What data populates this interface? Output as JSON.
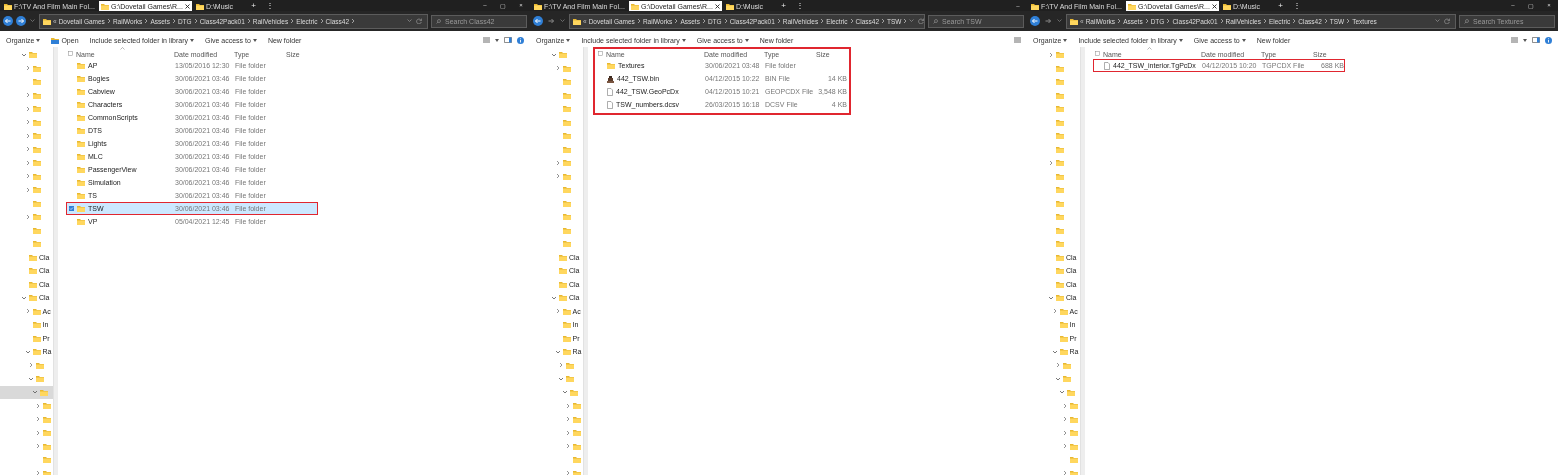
{
  "windows": [
    {
      "tabs": [
        {
          "label": "F:\\TV And Film Main Fol...",
          "selected": false
        },
        {
          "label": "G:\\Dovetail Games\\R...",
          "selected": true
        },
        {
          "label": "D:\\Music",
          "selected": false
        }
      ],
      "new_tab": "+",
      "tab_menu": "⋮",
      "window_controls": [
        "–",
        "▢",
        "×"
      ],
      "back_enabled": true,
      "forward_enabled": true,
      "address": {
        "overflow": "«",
        "crumbs": [
          "Dovetail Games",
          "RailWorks",
          "Assets",
          "DTG",
          "Class42Pack01",
          "RailVehicles",
          "Electric",
          "Class42"
        ],
        "trailing_chevron": true
      },
      "search": {
        "placeholder": "Search Class42"
      },
      "toolbar": [
        {
          "label": "Organize",
          "dropdown": true,
          "icon": false
        },
        {
          "label": "Open",
          "dropdown": false,
          "icon": true
        },
        {
          "label": "Include selected folder in library",
          "dropdown": true,
          "icon": false
        },
        {
          "label": "Give access to",
          "dropdown": true,
          "icon": false
        },
        {
          "label": "New folder",
          "dropdown": false,
          "icon": false
        }
      ],
      "view_buttons": [
        {
          "kind": "list"
        },
        {
          "kind": "caret"
        },
        {
          "kind": "pane"
        },
        {
          "kind": "help"
        }
      ],
      "tree": [
        {
          "expandable": true,
          "expanded": true,
          "selected": false,
          "children": [
            {
              "expandable": true,
              "expanded": false,
              "selected": false
            },
            {
              "expandable": false,
              "selected": false
            },
            {
              "expandable": true,
              "expanded": false,
              "selected": false
            },
            {
              "expandable": true,
              "expanded": false,
              "selected": false
            },
            {
              "expandable": true,
              "expanded": false,
              "selected": false
            },
            {
              "expandable": true,
              "expanded": false,
              "selected": false
            },
            {
              "expandable": true,
              "expanded": false,
              "selected": false
            },
            {
              "expandable": true,
              "expanded": false,
              "selected": false
            },
            {
              "expandable": true,
              "expanded": false,
              "selected": false
            },
            {
              "expandable": true,
              "expanded": false,
              "selected": false
            },
            {
              "expandable": false,
              "selected": false
            },
            {
              "expandable": true,
              "expanded": false,
              "selected": false
            },
            {
              "expandable": false,
              "selected": false
            },
            {
              "expandable": false,
              "selected": false
            }
          ]
        },
        {
          "label": "Cla",
          "expandable": false,
          "selected": false
        },
        {
          "label": "Cla",
          "expandable": false,
          "selected": false
        },
        {
          "label": "Cla",
          "expandable": false,
          "selected": false
        },
        {
          "label": "Cla",
          "expandable": true,
          "expanded": true,
          "selected": false,
          "children": [
            {
              "label": "Ac",
              "expandable": true,
              "expanded": false,
              "selected": false
            },
            {
              "label": "In",
              "expandable": false,
              "selected": false
            },
            {
              "label": "Pr",
              "expandable": false,
              "selected": false
            },
            {
              "label": "Ra",
              "expandable": true,
              "expanded": true,
              "selected": false,
              "children": [
                {
                  "expandable": true,
                  "expanded": false,
                  "selected": false
                },
                {
                  "expandable": true,
                  "expanded": true,
                  "selected": false,
                  "children": [
                    {
                      "expandable": true,
                      "expanded": true,
                      "selected": true,
                      "children": [
                        {
                          "expandable": true,
                          "expanded": false,
                          "selected": false
                        },
                        {
                          "expandable": true,
                          "expanded": false,
                          "selected": false
                        },
                        {
                          "expandable": true,
                          "expanded": false,
                          "selected": false
                        },
                        {
                          "expandable": true,
                          "expanded": false,
                          "selected": false
                        },
                        {
                          "expandable": false,
                          "selected": false
                        },
                        {
                          "expandable": true,
                          "expanded": false,
                          "selected": false
                        }
                      ]
                    }
                  ]
                }
              ]
            }
          ]
        }
      ],
      "columns": [
        {
          "label": "Name",
          "sorted": true
        },
        {
          "label": "Date modified",
          "sorted": false
        },
        {
          "label": "Type",
          "sorted": false
        },
        {
          "label": "Size",
          "sorted": false
        }
      ],
      "header_checkbox": {
        "checked": false
      },
      "list_highlighted": false,
      "rows": [
        {
          "kind": "folder",
          "name": "AP",
          "date": "13/05/2016 12:30",
          "type": "File folder",
          "selected": false,
          "highlighted": false
        },
        {
          "kind": "folder",
          "name": "Bogies",
          "date": "30/06/2021 03:46",
          "type": "File folder",
          "selected": false,
          "highlighted": false
        },
        {
          "kind": "folder",
          "name": "Cabview",
          "date": "30/06/2021 03:46",
          "type": "File folder",
          "selected": false,
          "highlighted": false
        },
        {
          "kind": "folder",
          "name": "Characters",
          "date": "30/06/2021 03:46",
          "type": "File folder",
          "selected": false,
          "highlighted": false
        },
        {
          "kind": "folder",
          "name": "CommonScripts",
          "date": "30/06/2021 03:46",
          "type": "File folder",
          "selected": false,
          "highlighted": false
        },
        {
          "kind": "folder",
          "name": "DTS",
          "date": "30/06/2021 03:46",
          "type": "File folder",
          "selected": false,
          "highlighted": false
        },
        {
          "kind": "folder",
          "name": "Lights",
          "date": "30/06/2021 03:46",
          "type": "File folder",
          "selected": false,
          "highlighted": false
        },
        {
          "kind": "folder",
          "name": "MLC",
          "date": "30/06/2021 03:46",
          "type": "File folder",
          "selected": false,
          "highlighted": false
        },
        {
          "kind": "folder",
          "name": "PassengerView",
          "date": "30/06/2021 03:46",
          "type": "File folder",
          "selected": false,
          "highlighted": false
        },
        {
          "kind": "folder",
          "name": "Simulation",
          "date": "30/06/2021 03:46",
          "type": "File folder",
          "selected": false,
          "highlighted": false
        },
        {
          "kind": "folder",
          "name": "TS",
          "date": "30/06/2021 03:46",
          "type": "File folder",
          "selected": false,
          "highlighted": false
        },
        {
          "kind": "folder",
          "name": "TSW",
          "date": "30/06/2021 03:46",
          "type": "File folder",
          "selected": true,
          "highlighted": true
        },
        {
          "kind": "folder",
          "name": "VP",
          "date": "05/04/2021 12:45",
          "type": "File folder",
          "selected": false,
          "highlighted": false
        }
      ]
    },
    {
      "tabs": [
        {
          "label": "F:\\TV And Film Main Fol...",
          "selected": false
        },
        {
          "label": "G:\\Dovetail Games\\R...",
          "selected": true
        },
        {
          "label": "D:\\Music",
          "selected": false
        }
      ],
      "new_tab": "+",
      "tab_menu": "⋮",
      "window_controls": [
        "–"
      ],
      "back_enabled": true,
      "forward_enabled": false,
      "address": {
        "overflow": "«",
        "crumbs": [
          "Dovetail Games",
          "RailWorks",
          "Assets",
          "DTG",
          "Class42Pack01",
          "RailVehicles",
          "Electric",
          "Class42",
          "TSW"
        ],
        "trailing_chevron": true
      },
      "search": {
        "placeholder": "Search TSW"
      },
      "toolbar": [
        {
          "label": "Organize",
          "dropdown": true,
          "icon": false
        },
        {
          "label": "Include selected folder in library",
          "dropdown": true,
          "icon": false
        },
        {
          "label": "Give access to",
          "dropdown": true,
          "icon": false
        },
        {
          "label": "New folder",
          "dropdown": false,
          "icon": false
        }
      ],
      "view_buttons": [
        {
          "kind": "list"
        }
      ],
      "tree": [
        {
          "expandable": true,
          "expanded": true,
          "selected": false,
          "children": [
            {
              "expandable": true,
              "expanded": false,
              "selected": false
            },
            {
              "expandable": false,
              "selected": false
            },
            {
              "expandable": false,
              "selected": false
            },
            {
              "expandable": false,
              "selected": false
            },
            {
              "expandable": false,
              "selected": false
            },
            {
              "expandable": false,
              "selected": false
            },
            {
              "expandable": false,
              "selected": false
            },
            {
              "expandable": true,
              "expanded": false,
              "selected": false
            },
            {
              "expandable": true,
              "expanded": false,
              "selected": false
            },
            {
              "expandable": false,
              "selected": false
            },
            {
              "expandable": false,
              "selected": false
            },
            {
              "expandable": false,
              "selected": false
            },
            {
              "expandable": false,
              "selected": false
            },
            {
              "expandable": false,
              "selected": false
            }
          ]
        },
        {
          "label": "Cla",
          "expandable": false,
          "selected": false
        },
        {
          "label": "Cla",
          "expandable": false,
          "selected": false
        },
        {
          "label": "Cla",
          "expandable": false,
          "selected": false
        },
        {
          "label": "Cla",
          "expandable": true,
          "expanded": true,
          "selected": false,
          "children": [
            {
              "label": "Ac",
              "expandable": true,
              "expanded": false,
              "selected": false
            },
            {
              "label": "In",
              "expandable": false,
              "selected": false
            },
            {
              "label": "Pr",
              "expandable": false,
              "selected": false
            },
            {
              "label": "Ra",
              "expandable": true,
              "expanded": true,
              "selected": false,
              "children": [
                {
                  "expandable": true,
                  "expanded": false,
                  "selected": false
                },
                {
                  "expandable": true,
                  "expanded": true,
                  "selected": false,
                  "children": [
                    {
                      "expandable": true,
                      "expanded": true,
                      "selected": false,
                      "children": [
                        {
                          "expandable": true,
                          "expanded": false,
                          "selected": false
                        },
                        {
                          "expandable": true,
                          "expanded": false,
                          "selected": false
                        },
                        {
                          "expandable": true,
                          "expanded": false,
                          "selected": false
                        },
                        {
                          "expandable": true,
                          "expanded": false,
                          "selected": false
                        },
                        {
                          "expandable": false,
                          "selected": false
                        },
                        {
                          "expandable": true,
                          "expanded": false,
                          "selected": false
                        }
                      ]
                    }
                  ]
                }
              ]
            }
          ]
        }
      ],
      "columns": [
        {
          "label": "Name",
          "sorted": false
        },
        {
          "label": "Date modified",
          "sorted": false
        },
        {
          "label": "Type",
          "sorted": false
        },
        {
          "label": "Size",
          "sorted": false
        }
      ],
      "header_checkbox": {
        "checked": false
      },
      "list_highlighted": true,
      "rows": [
        {
          "kind": "folder",
          "name": "Textures",
          "date": "30/06/2021 03:48",
          "type": "File folder",
          "selected": false,
          "highlighted": false
        },
        {
          "kind": "bin",
          "name": "442_TSW.bin",
          "date": "04/12/2015 10:22",
          "type": "BIN File",
          "size": "14 KB",
          "selected": false,
          "highlighted": false
        },
        {
          "kind": "file",
          "name": "442_TSW.GeoPcDx",
          "date": "04/12/2015 10:21",
          "type": "GEOPCDX File",
          "size": "3,548 KB",
          "selected": false,
          "highlighted": false
        },
        {
          "kind": "file",
          "name": "TSW_numbers.dcsv",
          "date": "26/03/2015 16:18",
          "type": "DCSV File",
          "size": "4 KB",
          "selected": false,
          "highlighted": false
        }
      ]
    },
    {
      "tabs": [
        {
          "label": "F:\\TV And Film Main Fol...",
          "selected": false
        },
        {
          "label": "G:\\Dovetail Games\\R...",
          "selected": true
        },
        {
          "label": "D:\\Music",
          "selected": false
        }
      ],
      "new_tab": "+",
      "tab_menu": "⋮",
      "window_controls": [
        "–",
        "▢",
        "×"
      ],
      "back_enabled": true,
      "forward_enabled": false,
      "address": {
        "overflow": "«",
        "crumbs": [
          "RailWorks",
          "Assets",
          "DTG",
          "Class42Pack01",
          "RailVehicles",
          "Electric",
          "Class42",
          "TSW",
          "Textures"
        ],
        "trailing_chevron": false
      },
      "search": {
        "placeholder": "Search Textures"
      },
      "toolbar": [
        {
          "label": "Organize",
          "dropdown": true,
          "icon": false
        },
        {
          "label": "Include selected folder in library",
          "dropdown": true,
          "icon": false
        },
        {
          "label": "Give access to",
          "dropdown": true,
          "icon": false
        },
        {
          "label": "New folder",
          "dropdown": false,
          "icon": false
        }
      ],
      "view_buttons": [
        {
          "kind": "list"
        },
        {
          "kind": "caret"
        },
        {
          "kind": "pane"
        },
        {
          "kind": "help"
        }
      ],
      "tree": [
        {
          "expandable": true,
          "expanded": false,
          "selected": false
        },
        {
          "expandable": false,
          "selected": false
        },
        {
          "expandable": false,
          "selected": false
        },
        {
          "expandable": false,
          "selected": false
        },
        {
          "expandable": false,
          "selected": false
        },
        {
          "expandable": false,
          "selected": false
        },
        {
          "expandable": false,
          "selected": false
        },
        {
          "expandable": false,
          "selected": false
        },
        {
          "expandable": true,
          "expanded": false,
          "selected": false
        },
        {
          "expandable": false,
          "selected": false
        },
        {
          "expandable": false,
          "selected": false
        },
        {
          "expandable": false,
          "selected": false
        },
        {
          "expandable": false,
          "selected": false
        },
        {
          "expandable": false,
          "selected": false
        },
        {
          "expandable": false,
          "selected": false
        },
        {
          "label": "Cla",
          "expandable": false,
          "selected": false
        },
        {
          "label": "Cla",
          "expandable": false,
          "selected": false
        },
        {
          "label": "Cla",
          "expandable": false,
          "selected": false
        },
        {
          "label": "Cla",
          "expandable": true,
          "expanded": true,
          "selected": false,
          "children": [
            {
              "label": "Ac",
              "expandable": true,
              "expanded": false,
              "selected": false
            },
            {
              "label": "In",
              "expandable": false,
              "selected": false
            },
            {
              "label": "Pr",
              "expandable": false,
              "selected": false
            },
            {
              "label": "Ra",
              "expandable": true,
              "expanded": true,
              "selected": false,
              "children": [
                {
                  "expandable": true,
                  "expanded": false,
                  "selected": false
                },
                {
                  "expandable": true,
                  "expanded": true,
                  "selected": false,
                  "children": [
                    {
                      "expandable": true,
                      "expanded": true,
                      "selected": false,
                      "children": [
                        {
                          "expandable": true,
                          "expanded": false,
                          "selected": false
                        },
                        {
                          "expandable": true,
                          "expanded": false,
                          "selected": false
                        },
                        {
                          "expandable": true,
                          "expanded": false,
                          "selected": false
                        },
                        {
                          "expandable": true,
                          "expanded": false,
                          "selected": false
                        },
                        {
                          "expandable": false,
                          "selected": false
                        },
                        {
                          "expandable": true,
                          "expanded": false,
                          "selected": false
                        }
                      ]
                    }
                  ]
                }
              ]
            }
          ]
        }
      ],
      "columns": [
        {
          "label": "Name",
          "sorted": true
        },
        {
          "label": "Date modified",
          "sorted": false
        },
        {
          "label": "Type",
          "sorted": false
        },
        {
          "label": "Size",
          "sorted": false
        }
      ],
      "header_checkbox": {
        "checked": false
      },
      "list_highlighted": false,
      "rows": [
        {
          "kind": "file",
          "name": "442_TSW_interior.TgPcDx",
          "date": "04/12/2015 10:20",
          "type": "TGPCDX File",
          "size": "688 KB",
          "selected": false,
          "highlighted": true
        }
      ]
    }
  ]
}
